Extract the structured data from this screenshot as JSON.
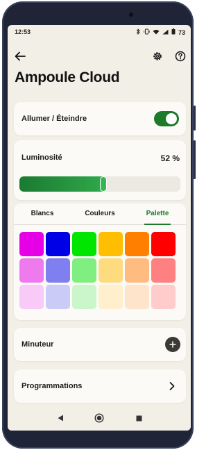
{
  "status_bar": {
    "time": "12:53",
    "battery": "73"
  },
  "header": {
    "title": "Ampoule Cloud"
  },
  "power": {
    "label": "Allumer / Éteindre",
    "on": true
  },
  "brightness": {
    "label": "Luminosité",
    "value_text": "52 %",
    "level": 0.52
  },
  "color_tabs": {
    "items": [
      "Blancs",
      "Couleurs",
      "Palette"
    ],
    "active": 2
  },
  "palette": {
    "rows": [
      [
        "#e600e6",
        "#0000e6",
        "#00e600",
        "#ffbf00",
        "#ff8000",
        "#ff0000"
      ],
      [
        "#ee7aee",
        "#7f7ff0",
        "#80ee80",
        "#ffdb80",
        "#ffbb80",
        "#ff8080"
      ],
      [
        "#f8caf8",
        "#cbcbf8",
        "#cbf6cb",
        "#ffefcc",
        "#ffe4cc",
        "#ffcbcb"
      ]
    ]
  },
  "timer": {
    "label": "Minuteur"
  },
  "schedules": {
    "label": "Programmations"
  },
  "colors": {
    "accent": "#1e7a2b",
    "background": "#f2efe7",
    "card": "#fbfaf6"
  }
}
